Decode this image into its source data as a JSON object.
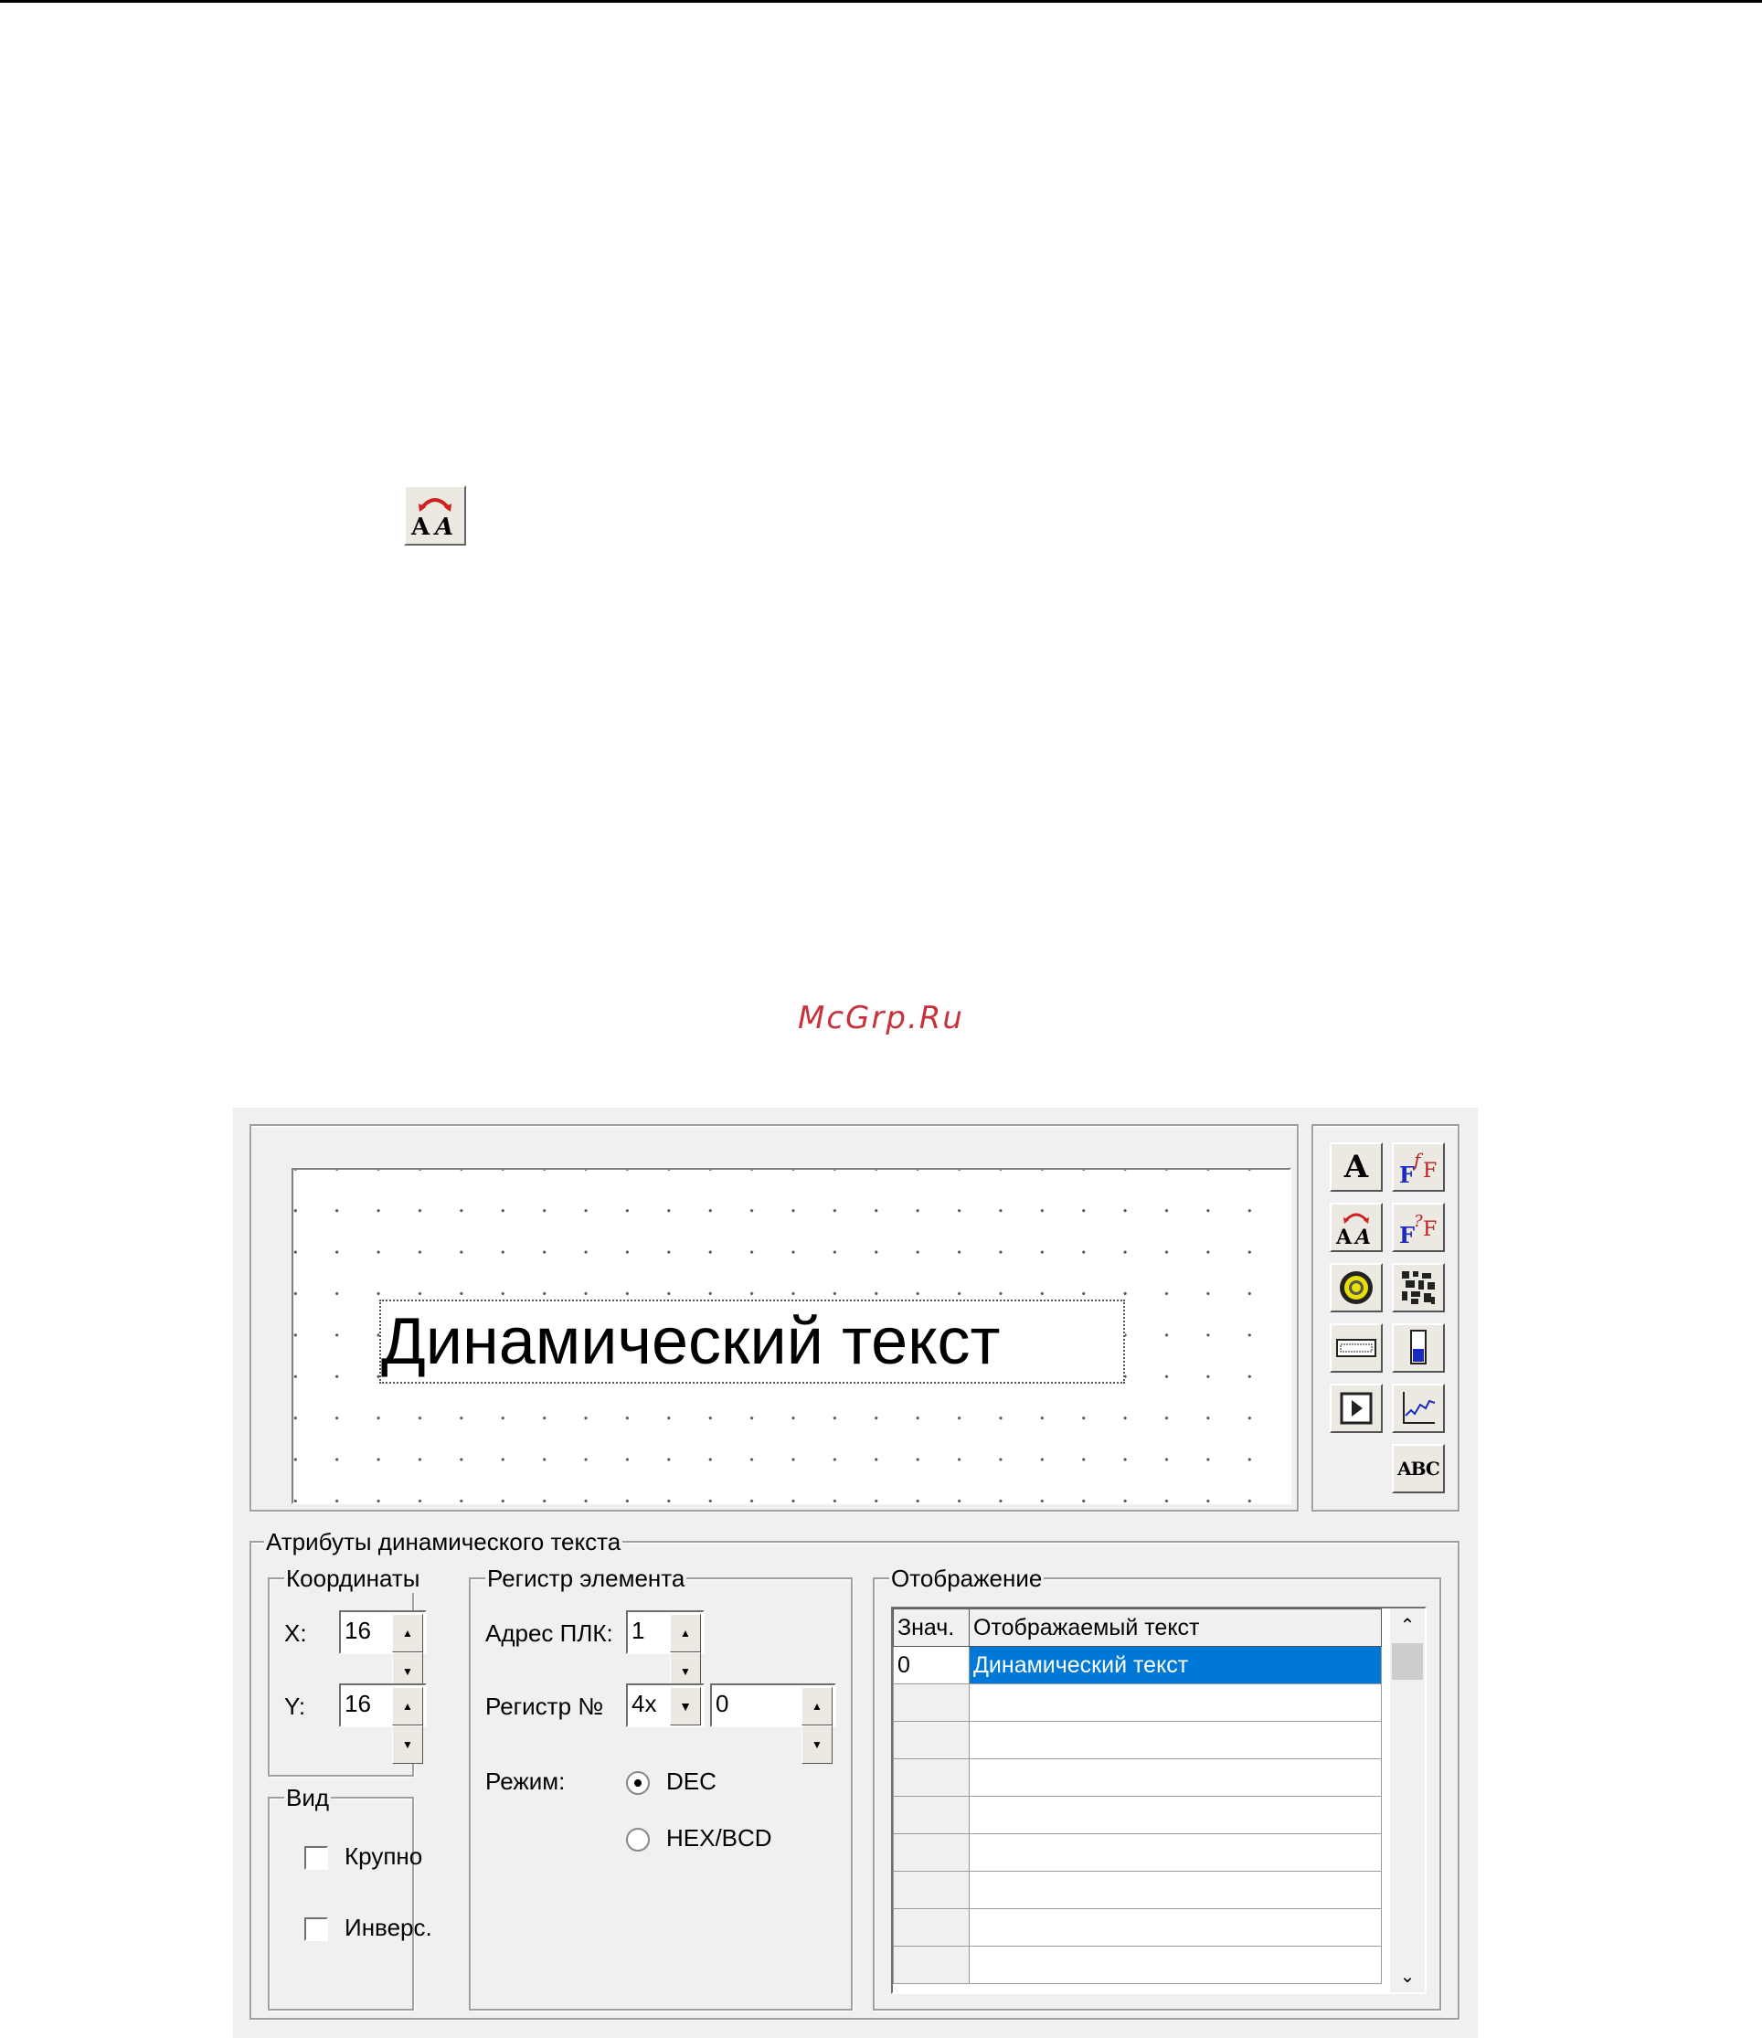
{
  "watermark": "McGrp.Ru",
  "icons": {
    "standalone": "dynamic-text-tool-icon"
  },
  "preview": {
    "sample_text": "Динамический текст"
  },
  "toolbox": {
    "static_text": "A",
    "dynamic_text": "AA",
    "abc": "ABC"
  },
  "attributes": {
    "title": "Атрибуты динамического текста",
    "coords": {
      "title": "Координаты",
      "x_label": "X:",
      "x_value": "16",
      "y_label": "Y:",
      "y_value": "16"
    },
    "view": {
      "title": "Вид",
      "large_label": "Крупно",
      "invert_label": "Инверс."
    },
    "register": {
      "title": "Регистр элемента",
      "plc_label": "Адрес ПЛК:",
      "plc_value": "1",
      "reg_label": "Регистр №",
      "reg_type": "4x",
      "reg_value": "0",
      "mode_label": "Режим:",
      "mode_dec": "DEC",
      "mode_hex": "HEX/BCD"
    },
    "display": {
      "title": "Отображение",
      "col_value": "Знач.",
      "col_text": "Отображаемый текст",
      "row0_value": "0",
      "row0_text": "Динамический текст"
    }
  }
}
